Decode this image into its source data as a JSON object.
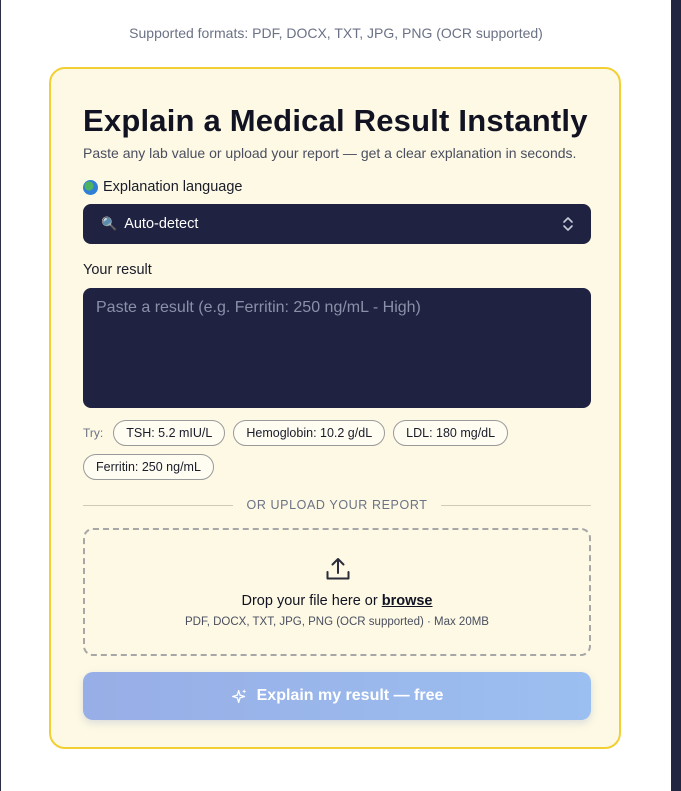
{
  "header": {
    "supported_formats_note": "Supported formats: PDF, DOCX, TXT, JPG, PNG (OCR supported)"
  },
  "card": {
    "title": "Explain a Medical Result Instantly",
    "subtitle": "Paste any lab value or upload your report — get a clear explanation in seconds."
  },
  "language": {
    "label": "Explanation language",
    "icon": "globe-icon",
    "selected": "Auto-detect",
    "selected_icon": "magnifier-icon"
  },
  "result": {
    "label": "Your result",
    "placeholder": "Paste a result (e.g. Ferritin: 250 ng/mL - High)",
    "value": ""
  },
  "examples": {
    "label": "Try:",
    "chips": [
      "TSH: 5.2 mIU/L",
      "Hemoglobin: 10.2 g/dL",
      "LDL: 180 mg/dL",
      "Ferritin: 250 ng/mL"
    ]
  },
  "upload": {
    "divider_text": "OR UPLOAD YOUR REPORT",
    "drop_text": "Drop your file here or ",
    "browse_label": "browse",
    "formats": "PDF, DOCX, TXT, JPG, PNG (OCR supported) · Max 20MB",
    "icon": "upload-icon"
  },
  "submit": {
    "label": "Explain my result — free",
    "icon": "sparkle-icon"
  },
  "colors": {
    "card_background": "#fdf9e4",
    "card_border": "#f2cf33",
    "input_background": "#1f2240",
    "button_gradient_start": "#98aee6",
    "button_gradient_end": "#9bbff0"
  }
}
